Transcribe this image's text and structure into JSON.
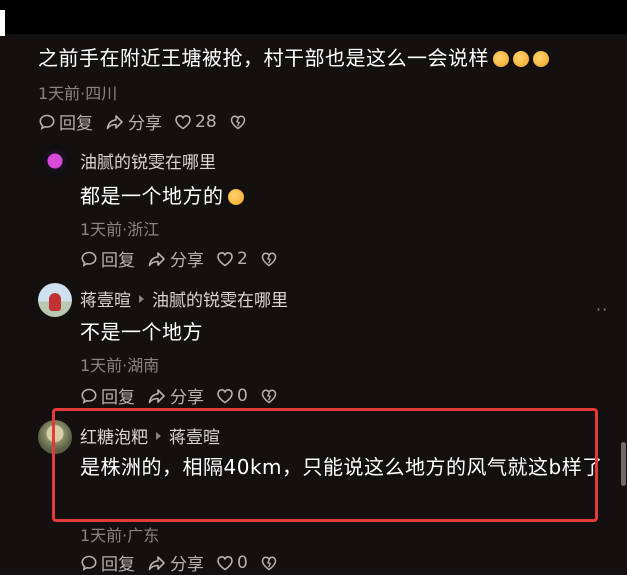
{
  "comments": [
    {
      "text": "之前手在附近王塘被抢，村干部也是这么一会说样",
      "time_location": "1天前·四川",
      "reply_label": "回复",
      "share_label": "分享",
      "like_count": "28"
    },
    {
      "username": "油腻的锐雯在哪里",
      "text": "都是一个地方的",
      "time_location": "1天前·浙江",
      "reply_label": "回复",
      "share_label": "分享",
      "like_count": "2"
    },
    {
      "username": "蒋壹暄",
      "reply_to": "油腻的锐雯在哪里",
      "text": "不是一个地方",
      "time_location": "1天前·湖南",
      "reply_label": "回复",
      "share_label": "分享",
      "like_count": "0"
    },
    {
      "username": "红糖泡粑",
      "reply_to": "蒋壹暄",
      "text": "是株洲的，相隔40km，只能说这么地方的风气就这b样了",
      "time_location": "1天前·广东",
      "reply_label": "回复",
      "share_label": "分享",
      "like_count": "0"
    }
  ],
  "more_menu": "··",
  "highlight_color": "#e53a3a"
}
